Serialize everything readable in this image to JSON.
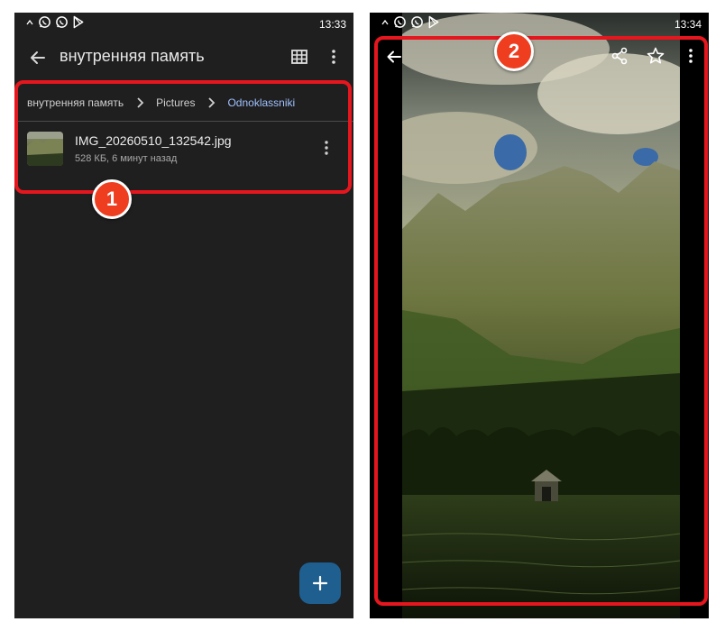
{
  "left_phone": {
    "status": {
      "time": "13:33",
      "icons": [
        "caret-up-icon",
        "whatsapp-icon",
        "whatsapp-icon",
        "play-store-icon"
      ]
    },
    "app_bar": {
      "title": "внутренняя память",
      "icons": [
        "back-arrow-icon",
        "grid-view-icon",
        "more-vert-icon"
      ]
    },
    "breadcrumb": {
      "items": [
        "внутренняя память",
        "Pictures",
        "Odnoklassniki"
      ],
      "separator_icon": "chevron-right-icon"
    },
    "file": {
      "name": "IMG_20260510_132542.jpg",
      "meta": "528 КБ, 6 минут назад"
    },
    "fab_icon": "plus-icon"
  },
  "right_phone": {
    "status": {
      "time": "13:34",
      "icons": [
        "caret-up-icon",
        "whatsapp-icon",
        "whatsapp-icon",
        "play-store-icon"
      ]
    },
    "toolbar_icons": [
      "back-arrow-icon",
      "share-icon",
      "star-icon",
      "more-vert-icon"
    ]
  },
  "annotations": [
    {
      "label": "1"
    },
    {
      "label": "2"
    }
  ],
  "colors": {
    "annotation_red": "#e6161e",
    "badge_red": "#ee3d1f",
    "breadcrumb_current": "#9fc1ff",
    "fab": "#1f5f8f",
    "app_background": "#1f1f1f"
  }
}
